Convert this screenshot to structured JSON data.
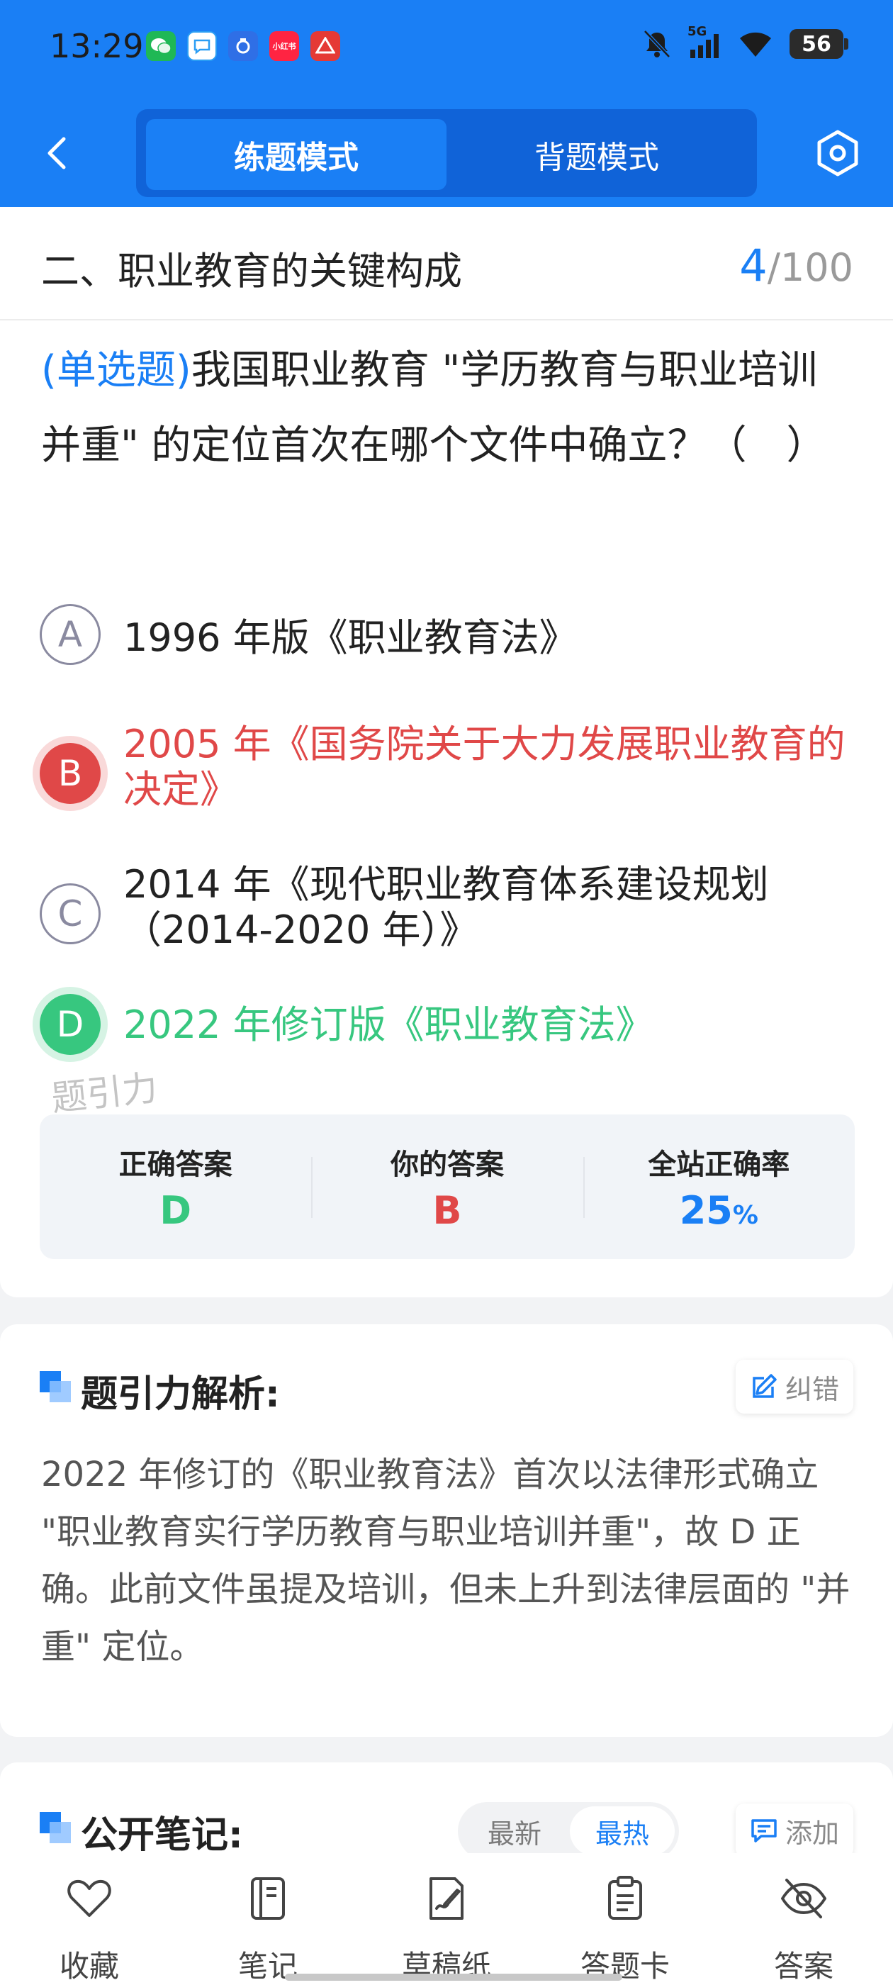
{
  "status_bar": {
    "time": "13:29",
    "apps": [
      {
        "name": "wechat-icon",
        "color": "#1fb855",
        "glyph": "●"
      },
      {
        "name": "message-icon",
        "color": "#2a9df4",
        "glyph": "◍"
      },
      {
        "name": "app-icon-blue",
        "color": "#2f6fe6",
        "glyph": "◉"
      },
      {
        "name": "xiaohongshu-icon",
        "color": "#ff2442",
        "glyph": "小红书"
      },
      {
        "name": "app-icon-red",
        "color": "#e53935",
        "glyph": "▲"
      }
    ],
    "network": "5G",
    "battery": "56"
  },
  "nav": {
    "tabs": [
      {
        "label": "练题模式",
        "active": true
      },
      {
        "label": "背题模式",
        "active": false
      }
    ]
  },
  "section": {
    "title": "二、职业教育的关键构成",
    "current": "4",
    "total": "/100"
  },
  "question": {
    "type_label": "(单选题)",
    "text": "我国职业教育 \"学历教育与职业培训并重\" 的定位首次在哪个文件中确立？（　）"
  },
  "options": [
    {
      "letter": "A",
      "text": "1996 年版《职业教育法》",
      "state": "plain"
    },
    {
      "letter": "B",
      "text": "2005 年《国务院关于大力发展职业教育的决定》",
      "state": "wrong"
    },
    {
      "letter": "C",
      "text": "2014 年《现代职业教育体系建设规划（2014-2020 年）》",
      "state": "plain"
    },
    {
      "letter": "D",
      "text": "2022 年修订版《职业教育法》",
      "state": "right"
    }
  ],
  "watermark": "题引力",
  "stats": {
    "correct_label": "正确答案",
    "correct_value": "D",
    "yours_label": "你的答案",
    "yours_value": "B",
    "rate_label": "全站正确率",
    "rate_value": "25",
    "rate_unit": "%"
  },
  "analysis": {
    "title": "题引力解析:",
    "report_label": "纠错",
    "text": "2022 年修订的《职业教育法》首次以法律形式确立 \"职业教育实行学历教育与职业培训并重\"，故 D 正确。此前文件虽提及培训，但未上升到法律层面的 \"并重\" 定位。"
  },
  "notes": {
    "title": "公开笔记:",
    "sort_latest": "最新",
    "sort_hot": "最热",
    "add_label": "添加"
  },
  "toolbar": {
    "favorite": "收藏",
    "notes": "笔记",
    "draft": "草稿纸",
    "answer_card": "答题卡",
    "answer": "答案"
  },
  "colors": {
    "primary": "#1a7ff5",
    "correct": "#37c77f",
    "wrong": "#e04848"
  }
}
